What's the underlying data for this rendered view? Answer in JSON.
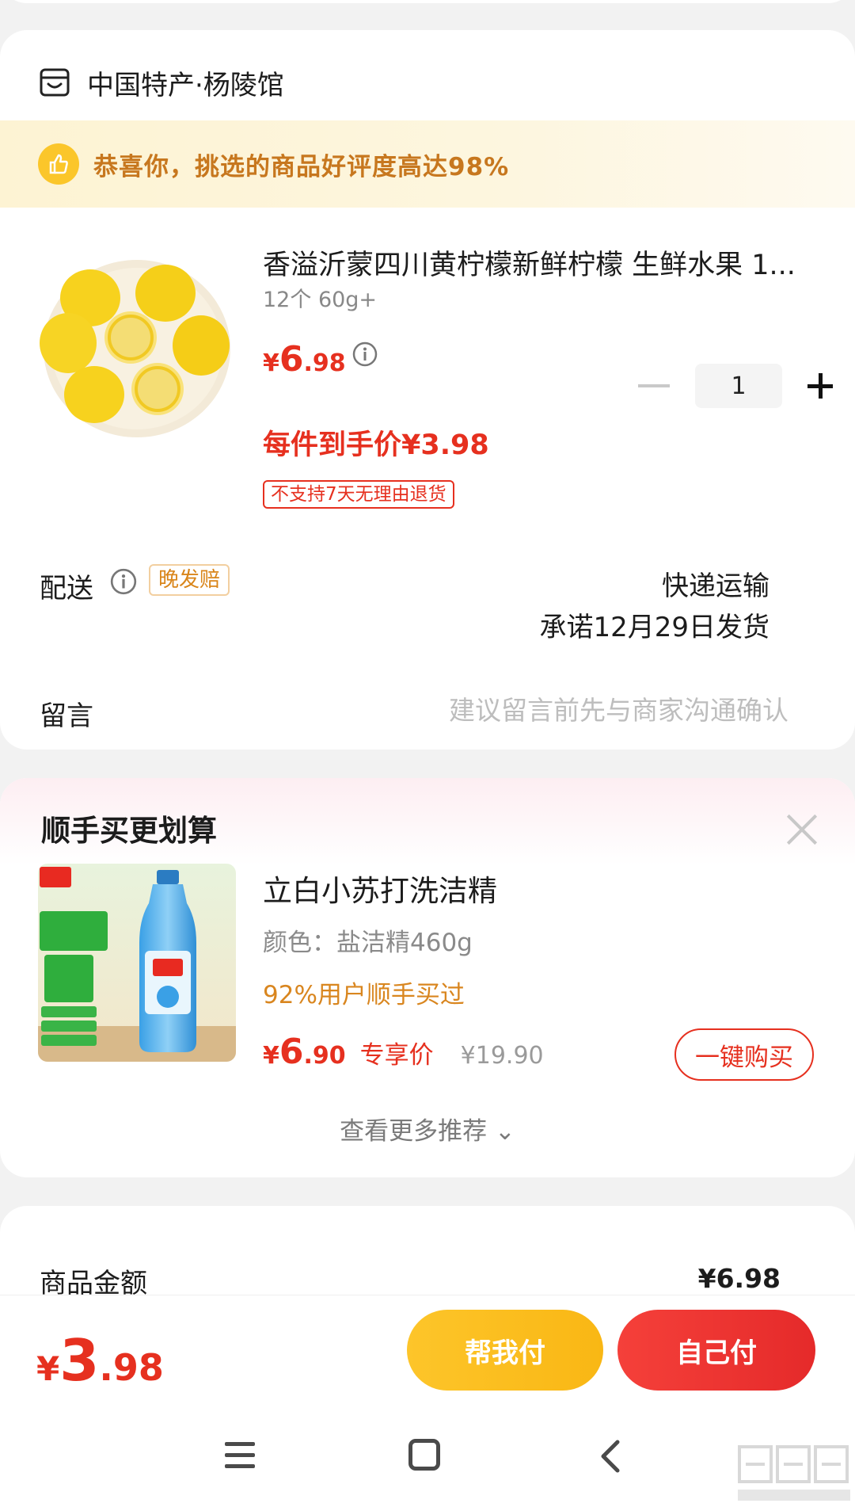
{
  "shop": {
    "name": "中国特产·杨陵馆",
    "promo": "恭喜你，挑选的商品好评度高达98%"
  },
  "product": {
    "title": "香溢沂蒙四川黄柠檬新鲜柠檬  生鲜水果 1...",
    "spec": "12个 60g+",
    "price_currency": "¥",
    "price_int": "6",
    "price_dec": ".98",
    "quantity": "1",
    "final_price": "每件到手价¥3.98",
    "tag": "不支持7天无理由退货"
  },
  "delivery": {
    "label": "配送",
    "badge": "晚发赔",
    "method": "快递运输",
    "promise": "承诺12月29日发货"
  },
  "message": {
    "label": "留言",
    "placeholder": "建议留言前先与商家沟通确认"
  },
  "recommend": {
    "title": "顺手买更划算",
    "item": {
      "name": "立白小苏打洗洁精",
      "variant": "颜色：盐洁精460g",
      "social_proof": "92%用户顺手买过",
      "price_currency": "¥",
      "price_int": "6",
      "price_dec": ".90",
      "price_label": "专享价",
      "original_price": "¥19.90",
      "buy_label": "一键购买"
    },
    "more_label": "查看更多推荐 ⌄"
  },
  "summary": {
    "label": "商品金额",
    "value": "¥6.98"
  },
  "checkout": {
    "total_currency": "¥",
    "total_int": "3",
    "total_dec": ".98",
    "help_pay_label": "帮我付",
    "self_pay_label": "自己付"
  },
  "colors": {
    "accent_red": "#e6301f",
    "accent_yellow": "#fbc62a",
    "promo_text": "#c7771e"
  }
}
